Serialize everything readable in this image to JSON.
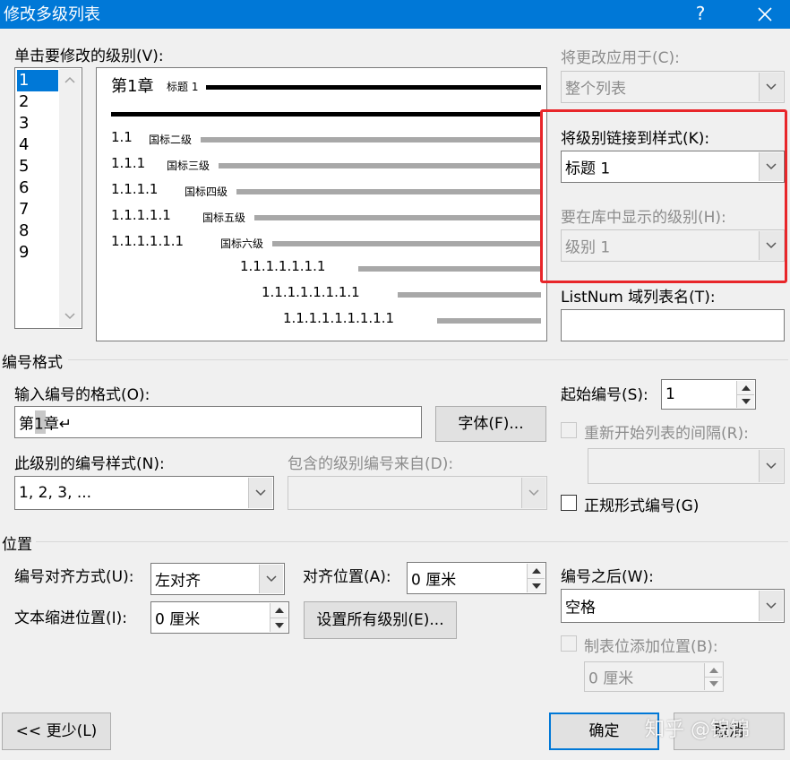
{
  "window": {
    "title": "修改多级列表",
    "help": "?",
    "close": "✕"
  },
  "level_select": {
    "label": "单击要修改的级别(V):",
    "items": [
      "1",
      "2",
      "3",
      "4",
      "5",
      "6",
      "7",
      "8",
      "9"
    ],
    "selected": "1"
  },
  "preview": {
    "chapter": "第1章",
    "chapter_style": "标题 1",
    "rows": [
      {
        "num": "1.1",
        "style": "国标二级"
      },
      {
        "num": "1.1.1",
        "style": "国标三级"
      },
      {
        "num": "1.1.1.1",
        "style": "国标四级"
      },
      {
        "num": "1.1.1.1.1",
        "style": "国标五级"
      },
      {
        "num": "1.1.1.1.1.1",
        "style": "国标六级"
      }
    ],
    "indent_rows": [
      "1.1.1.1.1.1.1",
      "1.1.1.1.1.1.1.1",
      "1.1.1.1.1.1.1.1.1"
    ]
  },
  "apply_to": {
    "label": "将更改应用于(C):",
    "value": "整个列表"
  },
  "link_style": {
    "label": "将级别链接到样式(K):",
    "value": "标题 1"
  },
  "gallery_level": {
    "label": "要在库中显示的级别(H):",
    "value": "级别 1"
  },
  "listnum": {
    "label": "ListNum 域列表名(T):",
    "value": ""
  },
  "number_format_section": {
    "title": "编号格式",
    "format_label": "输入编号的格式(O):",
    "format_value": "第1章↵",
    "font_button": "字体(F)...",
    "style_label": "此级别的编号样式(N):",
    "style_value": "1, 2, 3, ...",
    "include_label": "包含的级别编号来自(D):",
    "include_value": "",
    "start_label": "起始编号(S):",
    "start_value": "1",
    "restart_label": "重新开始列表的间隔(R):",
    "restart_value": "",
    "legal_label": "正规形式编号(G)"
  },
  "position_section": {
    "title": "位置",
    "align_label": "编号对齐方式(U):",
    "align_value": "左对齐",
    "align_at_label": "对齐位置(A):",
    "align_at_value": "0 厘米",
    "indent_label": "文本缩进位置(I):",
    "indent_value": "0 厘米",
    "set_all_button": "设置所有级别(E)...",
    "follow_label": "编号之后(W):",
    "follow_value": "空格",
    "tab_label": "制表位添加位置(B):",
    "tab_value": "0 厘米"
  },
  "footer": {
    "less_button": "<< 更少(L)",
    "ok_button": "确定",
    "cancel_button": "取消",
    "watermark": "知乎 @锦锦"
  },
  "highlight_color": "#e8262a",
  "accent_color": "#0078d7"
}
